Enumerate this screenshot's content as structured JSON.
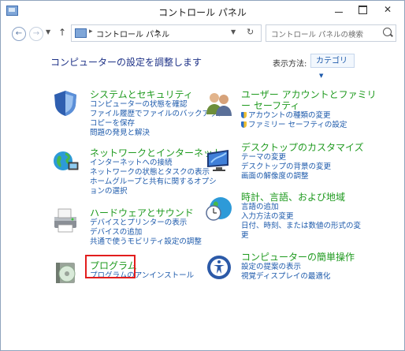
{
  "window": {
    "title": "コントロール パネル"
  },
  "address": {
    "path": "コントロール パネル",
    "search_placeholder": "コントロール パネルの検索"
  },
  "heading": "コンピューターの設定を調整します",
  "view": {
    "label": "表示方法:",
    "value": "カテゴリ"
  },
  "categories": [
    {
      "title": "システムとセキュリティ",
      "icon": "shield-icon",
      "links": [
        "コンピューターの状態を確認",
        "ファイル履歴でファイルのバックアップ",
        "コピーを保存",
        "問題の発見と解決"
      ]
    },
    {
      "title": "ネットワークとインターネット",
      "icon": "network-globe-icon",
      "links": [
        "インターネットへの接続",
        "ネットワークの状態とタスクの表示",
        "ホームグループと共有に関するオプシ",
        "ョンの選択"
      ]
    },
    {
      "title": "ハードウェアとサウンド",
      "icon": "printer-icon",
      "links": [
        "デバイスとプリンターの表示",
        "デバイスの追加",
        "共通で使うモビリティ設定の調整"
      ]
    },
    {
      "title": "プログラム",
      "icon": "programs-disc-icon",
      "links": [
        "プログラムのアンインストール"
      ]
    },
    {
      "title_lines": [
        "ユーザー アカウントとファミリ",
        "ー セーフティ"
      ],
      "icon": "users-icon",
      "links": [
        "アカウントの種類の変更",
        "ファミリー セーフティの設定"
      ]
    },
    {
      "title": "デスクトップのカスタマイズ",
      "icon": "desktop-monitor-icon",
      "links": [
        "テーマの変更",
        "デスクトップの背景の変更",
        "画面の解像度の調整"
      ]
    },
    {
      "title": "時計、言語、および地域",
      "icon": "clock-globe-icon",
      "links": [
        "言語の追加",
        "入力方法の変更",
        "日付、時刻、または数値の形式の変",
        "更"
      ]
    },
    {
      "title": "コンピューターの簡単操作",
      "icon": "ease-of-access-icon",
      "links": [
        "設定の提案の表示",
        "視覚ディスプレイの最適化"
      ]
    }
  ]
}
